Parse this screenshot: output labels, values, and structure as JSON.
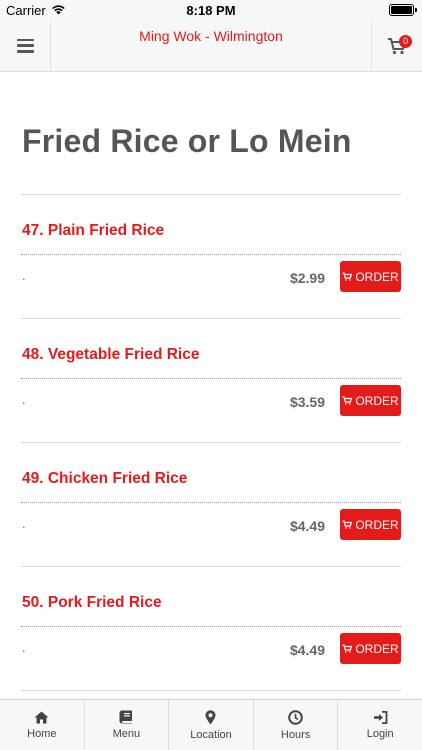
{
  "status_bar": {
    "carrier": "Carrier",
    "time": "8:18 PM"
  },
  "header": {
    "title": "Ming Wok - Wilmington",
    "cart_count": "0"
  },
  "page": {
    "title": "Fried Rice or Lo Mein"
  },
  "items": [
    {
      "name": "47. Plain Fried Rice",
      "description": ".",
      "price": "$2.99",
      "order_label": "ORDER"
    },
    {
      "name": "48. Vegetable Fried Rice",
      "description": ".",
      "price": "$3.59",
      "order_label": "ORDER"
    },
    {
      "name": "49. Chicken Fried Rice",
      "description": ".",
      "price": "$4.49",
      "order_label": "ORDER"
    },
    {
      "name": "50. Pork Fried Rice",
      "description": ".",
      "price": "$4.49",
      "order_label": "ORDER"
    }
  ],
  "tabbar": {
    "home": "Home",
    "menu": "Menu",
    "location": "Location",
    "hours": "Hours",
    "login": "Login"
  },
  "colors": {
    "accent": "#e31b1b",
    "title_gray": "#555555",
    "bar_bg": "#f7f7f7"
  },
  "icons": {
    "status": [
      "wifi-icon",
      "battery-icon"
    ],
    "header": [
      "hamburger-menu-icon",
      "cart-icon"
    ],
    "order": "cart-icon",
    "tabs": [
      "home-icon",
      "book-icon",
      "map-pin-icon",
      "clock-icon",
      "login-icon"
    ]
  }
}
